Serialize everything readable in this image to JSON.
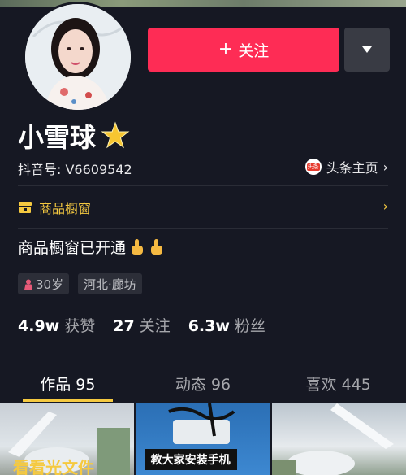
{
  "colors": {
    "background": "#161823",
    "follow": "#fe2c55",
    "accent": "#f5c940"
  },
  "header": {
    "follow_label": "关注",
    "follow_icon": "plus-icon",
    "more_icon": "triangle-down-icon"
  },
  "profile": {
    "name": "小雪球",
    "name_badge_icon": "star-icon",
    "douyin_id": "抖音号: V6609542",
    "toutiao_label": "头条主页",
    "toutiao_logo_text": "头条"
  },
  "shop": {
    "label": "商品橱窗"
  },
  "bio": {
    "text": "商品橱窗已开通"
  },
  "tags": {
    "age": "30岁",
    "location": "河北·廊坊"
  },
  "stats": [
    {
      "value": "4.9w",
      "label": "获赞"
    },
    {
      "value": "27",
      "label": "关注"
    },
    {
      "value": "6.3w",
      "label": "粉丝"
    }
  ],
  "tabs": [
    {
      "label": "作品 95"
    },
    {
      "label": "动态 96"
    },
    {
      "label": "喜欢 445"
    }
  ],
  "thumbnails": [
    {
      "caption": "看看光文件"
    },
    {
      "caption": "教大家安装手机"
    },
    {
      "caption": ""
    }
  ]
}
